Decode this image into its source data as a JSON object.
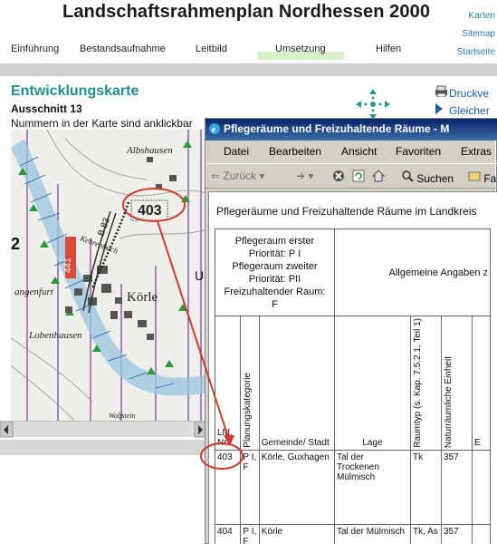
{
  "site": {
    "title": "Landschaftsrahmenplan Nordhessen 2000",
    "right_links": [
      "Karten",
      "Sitemap",
      "Startseite"
    ]
  },
  "nav": {
    "items": [
      "Einführung",
      "Bestandsaufnahme",
      "Leitbild",
      "Umsetzung",
      "Hilfen"
    ],
    "active": "Umsetzung"
  },
  "page": {
    "heading": "Entwicklungskarte",
    "subheading": "Ausschnitt 13",
    "note": "Nummern in der Karte sind anklickbar",
    "side_links": [
      "Druckve",
      "Gleicher"
    ]
  },
  "map": {
    "labels": {
      "town1": "Albshausen",
      "town2": "Körle",
      "town3": "Lobenhausen",
      "town4": "Wolfstein",
      "road": "B 83",
      "field": "Kehrenbach",
      "area": "angenfurt",
      "num1": "441",
      "num2": "403",
      "num3": "2",
      "num4": "U"
    }
  },
  "popup": {
    "title": "Pflegeräume und Freizuhaltende Räume - M",
    "menu": [
      "Datei",
      "Bearbeiten",
      "Ansicht",
      "Favoriten",
      "Extras"
    ],
    "toolbar": {
      "back": "Zurück",
      "search": "Suchen",
      "fav": "Fa"
    },
    "caption": "Pflegeräume und Freizuhaltende Räume im Landkreis",
    "legend_lines": [
      "Pflegeraum erster",
      "Priorität: P I",
      "Pflegeraum zweiter",
      "Priorität: PII",
      "Freizuhaltender Raum:",
      "F"
    ],
    "general_header": "Allgemeine Angaben z",
    "columns": {
      "nr": "Lfd. Nr.",
      "kategorie": "Planungskategorie",
      "gemeinde": "Gemeinde/ Stadt",
      "lage": "Lage",
      "raumtyp": "Raumtyp (s. Kap. 7.5.2.1, Teil 1)",
      "einheit": "Naturräumliche Einheit",
      "last": "E"
    },
    "rows": [
      {
        "nr": "403",
        "kategorie": "P I, F",
        "gemeinde": "Körle, Guxhagen",
        "lage": "Tal der Trockenen Mülmisch",
        "raumtyp": "Tk",
        "einheit": "357"
      },
      {
        "nr": "404",
        "kategorie": "P I, F",
        "gemeinde": "Körle",
        "lage": "Tal der Mülmisch",
        "raumtyp": "Tk, As",
        "einheit": "357"
      }
    ]
  },
  "colors": {
    "accent": "#1f8f8a",
    "link": "#1a5fa8",
    "annotation": "#d03a2a",
    "titlebar": "#0a246a"
  }
}
